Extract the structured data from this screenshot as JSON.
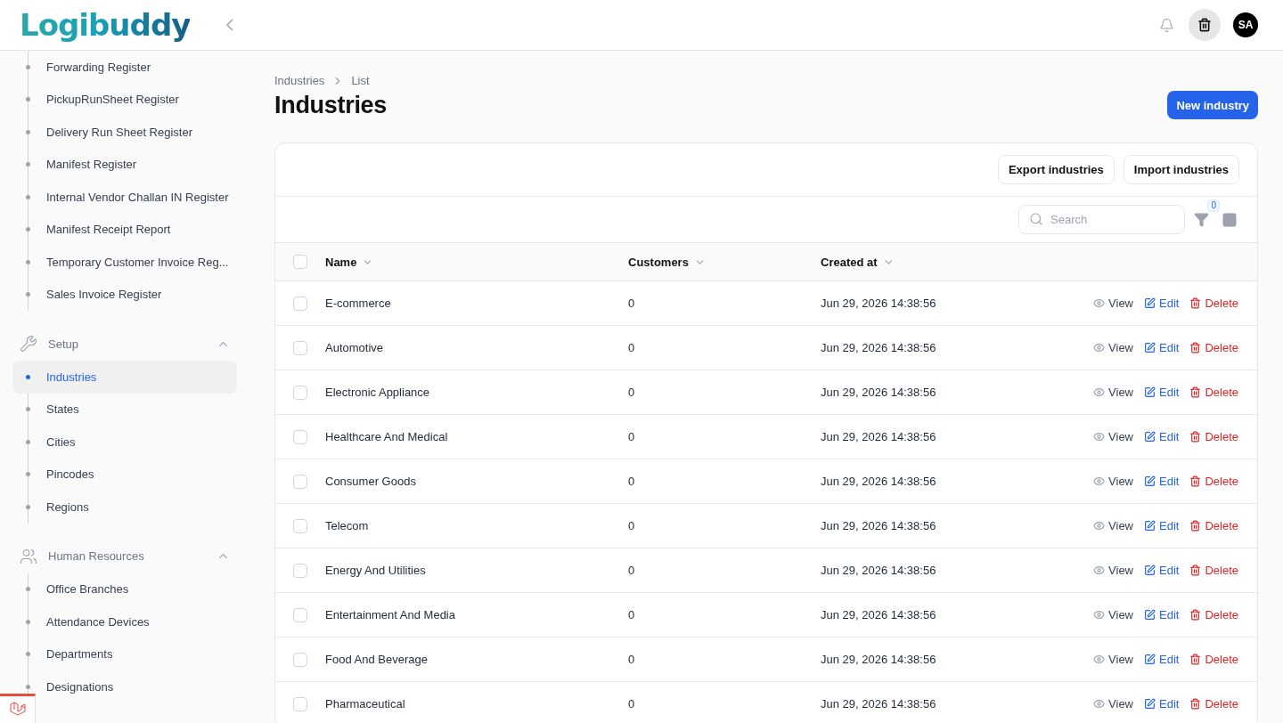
{
  "header": {
    "logo": "Logibuddy",
    "avatar": "SA"
  },
  "sidebar": {
    "groups": [
      {
        "items": [
          {
            "label": "Forwarding Register",
            "selected": false
          },
          {
            "label": "PickupRunSheet Register",
            "selected": false
          },
          {
            "label": "Delivery Run Sheet Register",
            "selected": false
          },
          {
            "label": "Manifest Register",
            "selected": false
          },
          {
            "label": "Internal Vendor Challan IN Register",
            "selected": false
          },
          {
            "label": "Manifest Receipt Report",
            "selected": false
          },
          {
            "label": "Temporary Customer Invoice Reg...",
            "selected": false
          },
          {
            "label": "Sales Invoice Register",
            "selected": false
          }
        ]
      },
      {
        "label": "Setup",
        "kind": "tools",
        "expanded": true,
        "items": [
          {
            "label": "Industries",
            "selected": true
          },
          {
            "label": "States",
            "selected": false
          },
          {
            "label": "Cities",
            "selected": false
          },
          {
            "label": "Pincodes",
            "selected": false
          },
          {
            "label": "Regions",
            "selected": false
          }
        ]
      },
      {
        "label": "Human Resources",
        "kind": "people",
        "expanded": true,
        "items": [
          {
            "label": "Office Branches",
            "selected": false
          },
          {
            "label": "Attendance Devices",
            "selected": false
          },
          {
            "label": "Departments",
            "selected": false
          },
          {
            "label": "Designations",
            "selected": false
          }
        ]
      }
    ]
  },
  "breadcrumbs": [
    "Industries",
    "List"
  ],
  "page_title": "Industries",
  "primary_action": "New industry",
  "table": {
    "header_actions": [
      "Export industries",
      "Import industries"
    ],
    "search": {
      "placeholder": "Search"
    },
    "filter_count": "0",
    "all_checked": false,
    "columns": [
      "Name",
      "Customers",
      "Created at"
    ],
    "rows": [
      {
        "checked": false,
        "name": "E-commerce",
        "customers": "0",
        "created_at": "Jun 29, 2026 14:38:56",
        "actions": [
          {
            "kind": "view",
            "label": "View"
          },
          {
            "kind": "edit",
            "label": "Edit"
          },
          {
            "kind": "delete",
            "label": "Delete"
          }
        ]
      },
      {
        "checked": false,
        "name": "Automotive",
        "customers": "0",
        "created_at": "Jun 29, 2026 14:38:56",
        "actions": [
          {
            "kind": "view",
            "label": "View"
          },
          {
            "kind": "edit",
            "label": "Edit"
          },
          {
            "kind": "delete",
            "label": "Delete"
          }
        ]
      },
      {
        "checked": false,
        "name": "Electronic Appliance",
        "customers": "0",
        "created_at": "Jun 29, 2026 14:38:56",
        "actions": [
          {
            "kind": "view",
            "label": "View"
          },
          {
            "kind": "edit",
            "label": "Edit"
          },
          {
            "kind": "delete",
            "label": "Delete"
          }
        ]
      },
      {
        "checked": false,
        "name": "Healthcare And Medical",
        "customers": "0",
        "created_at": "Jun 29, 2026 14:38:56",
        "actions": [
          {
            "kind": "view",
            "label": "View"
          },
          {
            "kind": "edit",
            "label": "Edit"
          },
          {
            "kind": "delete",
            "label": "Delete"
          }
        ]
      },
      {
        "checked": false,
        "name": "Consumer Goods",
        "customers": "0",
        "created_at": "Jun 29, 2026 14:38:56",
        "actions": [
          {
            "kind": "view",
            "label": "View"
          },
          {
            "kind": "edit",
            "label": "Edit"
          },
          {
            "kind": "delete",
            "label": "Delete"
          }
        ]
      },
      {
        "checked": false,
        "name": "Telecom",
        "customers": "0",
        "created_at": "Jun 29, 2026 14:38:56",
        "actions": [
          {
            "kind": "view",
            "label": "View"
          },
          {
            "kind": "edit",
            "label": "Edit"
          },
          {
            "kind": "delete",
            "label": "Delete"
          }
        ]
      },
      {
        "checked": false,
        "name": "Energy And Utilities",
        "customers": "0",
        "created_at": "Jun 29, 2026 14:38:56",
        "actions": [
          {
            "kind": "view",
            "label": "View"
          },
          {
            "kind": "edit",
            "label": "Edit"
          },
          {
            "kind": "delete",
            "label": "Delete"
          }
        ]
      },
      {
        "checked": false,
        "name": "Entertainment And Media",
        "customers": "0",
        "created_at": "Jun 29, 2026 14:38:56",
        "actions": [
          {
            "kind": "view",
            "label": "View"
          },
          {
            "kind": "edit",
            "label": "Edit"
          },
          {
            "kind": "delete",
            "label": "Delete"
          }
        ]
      },
      {
        "checked": false,
        "name": "Food And Beverage",
        "customers": "0",
        "created_at": "Jun 29, 2026 14:38:56",
        "actions": [
          {
            "kind": "view",
            "label": "View"
          },
          {
            "kind": "edit",
            "label": "Edit"
          },
          {
            "kind": "delete",
            "label": "Delete"
          }
        ]
      },
      {
        "checked": false,
        "name": "Pharmaceutical",
        "customers": "0",
        "created_at": "Jun 29, 2026 14:38:56",
        "actions": [
          {
            "kind": "view",
            "label": "View"
          },
          {
            "kind": "edit",
            "label": "Edit"
          },
          {
            "kind": "delete",
            "label": "Delete"
          }
        ]
      }
    ]
  }
}
